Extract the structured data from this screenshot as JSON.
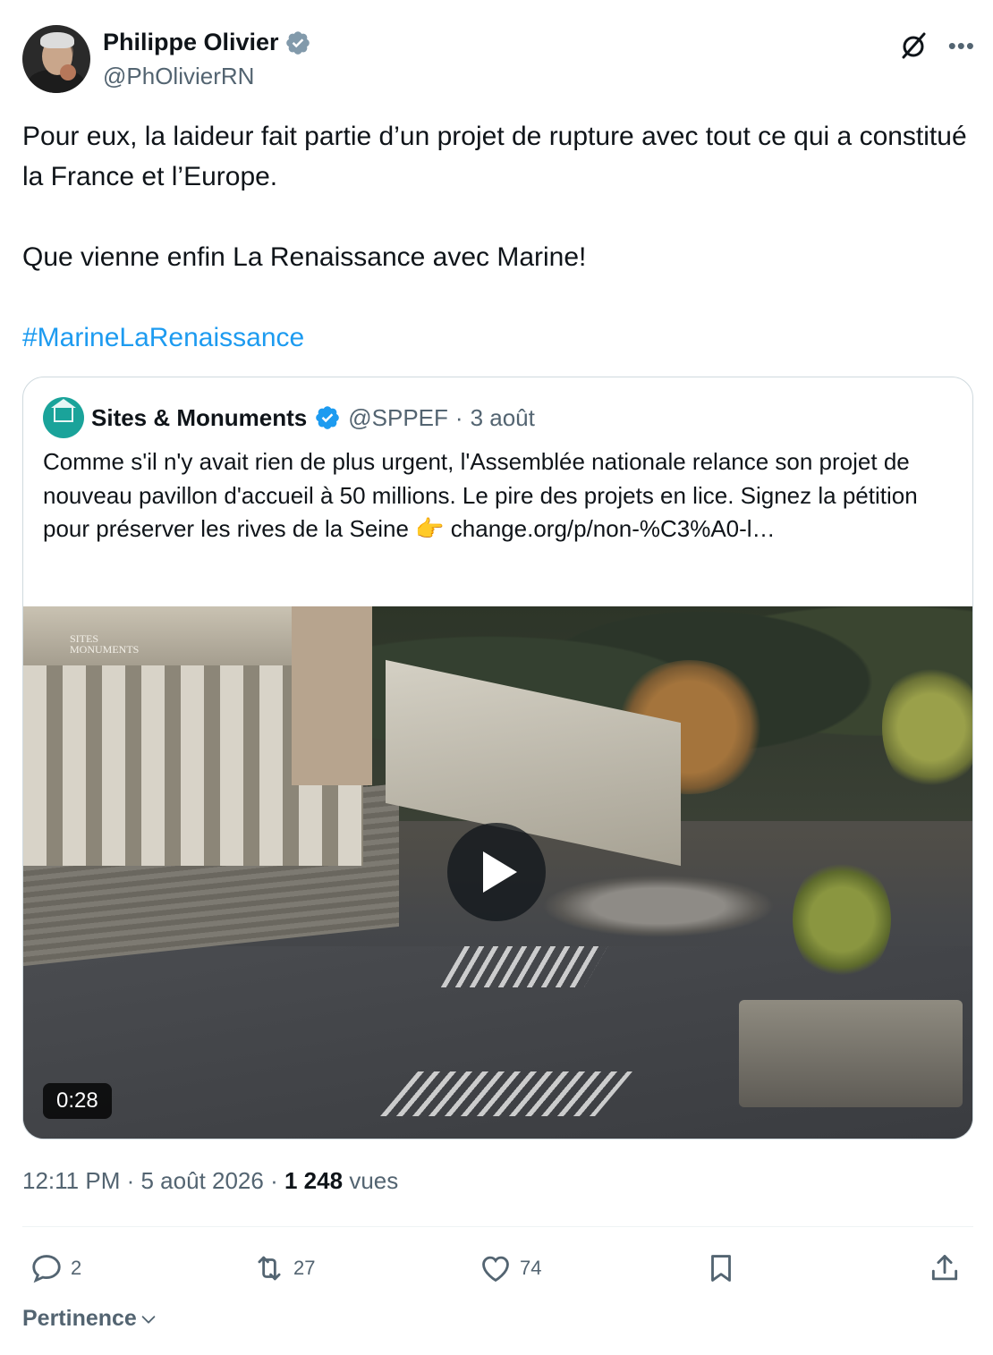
{
  "author": {
    "display_name": "Philippe Olivier",
    "handle": "@PhOlivierRN"
  },
  "icons": {
    "verified": "verified-badge-icon",
    "grok": "grok-icon",
    "more": "more-icon"
  },
  "tweet": {
    "line1": "Pour eux, la laideur fait partie d’un projet de rupture avec tout ce qui a constitué la France et l’Europe.",
    "line2": "Que vienne enfin La Renaissance avec Marine!",
    "hashtag": "#MarineLaRenaissance"
  },
  "quote": {
    "display_name": "Sites & Monuments",
    "handle": "@SPPEF",
    "separator": "·",
    "date": "3 août",
    "text": "Comme s'il n'y avait rien de plus urgent, l'Assemblée nationale relance son projet de nouveau pavillon d'accueil à 50 millions. Le pire des projets en lice. Signez la pétition pour préserver les rives de la Seine 👉 change.org/p/non-%C3%A0-l…",
    "watermark_line1": "SITES",
    "watermark_line2": "MONUMENTS",
    "video_duration": "0:28"
  },
  "meta": {
    "time": "12:11 PM",
    "sep1": "·",
    "date": "5 août 2026",
    "sep2": "·",
    "views_count": "1 248",
    "views_label": "vues"
  },
  "actions": {
    "replies": "2",
    "reposts": "27",
    "likes": "74"
  },
  "sort": {
    "label": "Pertinence"
  },
  "colors": {
    "accent": "#1d9bf0",
    "secondary_text": "#536471",
    "primary_text": "#0f1419",
    "border": "#cfd9de"
  }
}
